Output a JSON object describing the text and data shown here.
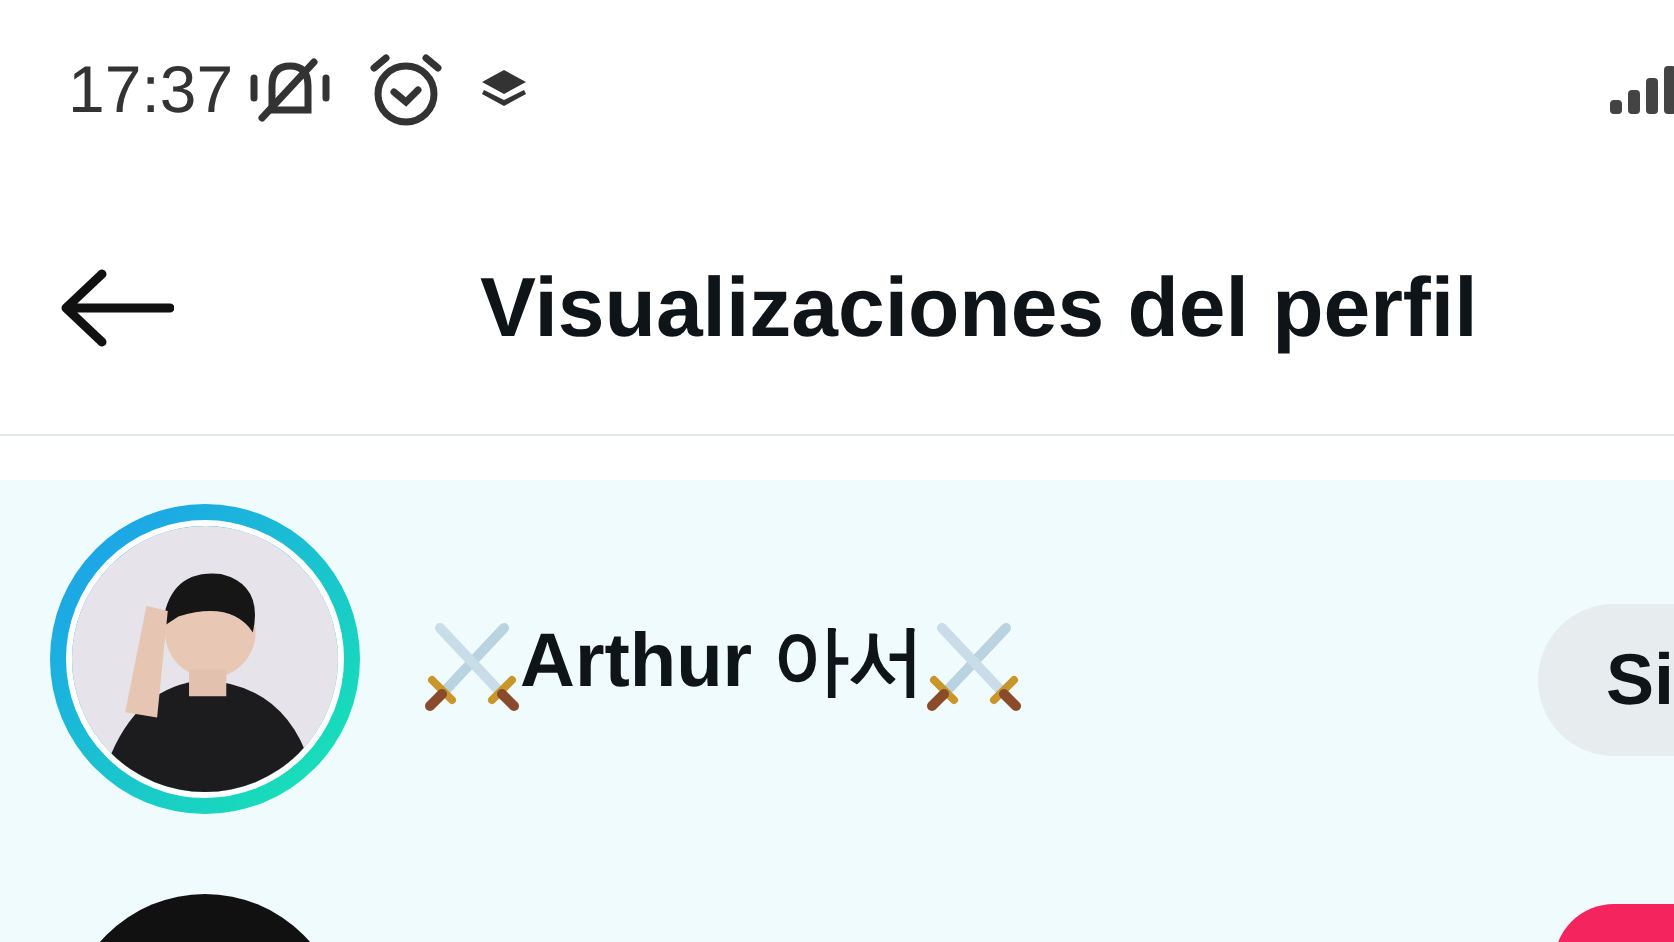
{
  "status_bar": {
    "time": "17:37"
  },
  "header": {
    "title": "Visualizaciones del perfil"
  },
  "viewers": [
    {
      "name": "Arthur 아서",
      "button": "Si",
      "story_ring": true
    },
    {
      "story_ring": false
    }
  ]
}
